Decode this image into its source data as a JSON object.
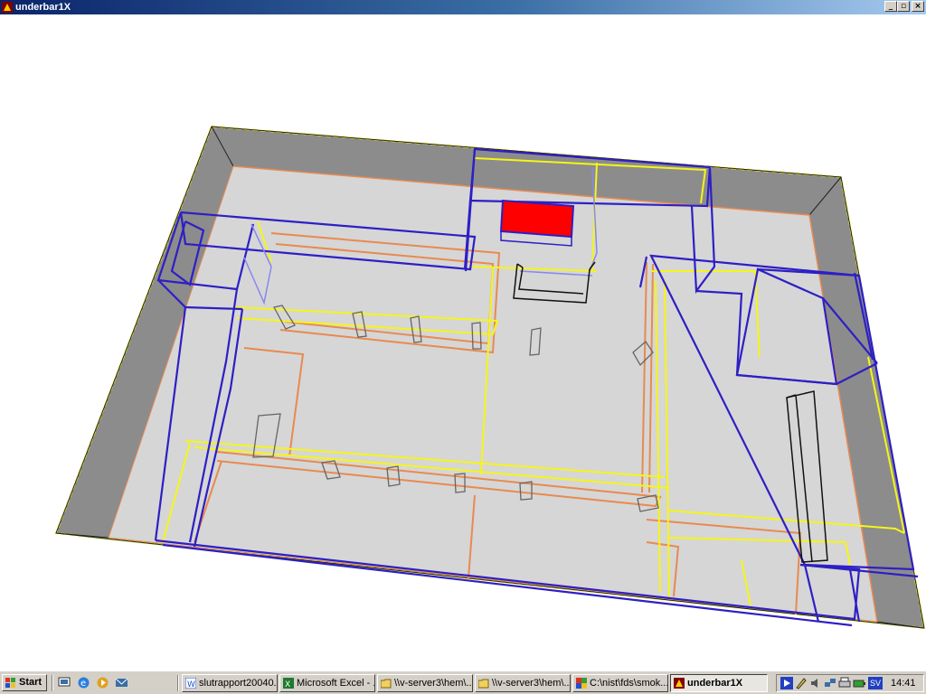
{
  "window": {
    "title": "underbar1X",
    "minimize": "_",
    "maximize": "▫",
    "close": "×"
  },
  "taskbar": {
    "start_label": "Start",
    "buttons": [
      {
        "label": "slutrapport20040...",
        "icon": "word-document-icon"
      },
      {
        "label": "Microsoft Excel - ...",
        "icon": "excel-icon"
      },
      {
        "label": "\\\\v-server3\\hem\\...",
        "icon": "folder-icon"
      },
      {
        "label": "\\\\v-server3\\hem\\...",
        "icon": "folder-icon"
      },
      {
        "label": "C:\\nist\\fds\\smok...",
        "icon": "console-icon"
      },
      {
        "label": "underbar1X",
        "icon": "smokeview-icon",
        "active": true
      }
    ],
    "tray_lang": "SV",
    "clock": "14:41"
  },
  "colors": {
    "wall": "#8c8c8c",
    "floor": "#d6d6d6",
    "obstruction": "#2e1fc4",
    "vent": "#f5f51a",
    "orange": "#e88a50",
    "burner": "#ff0000"
  }
}
